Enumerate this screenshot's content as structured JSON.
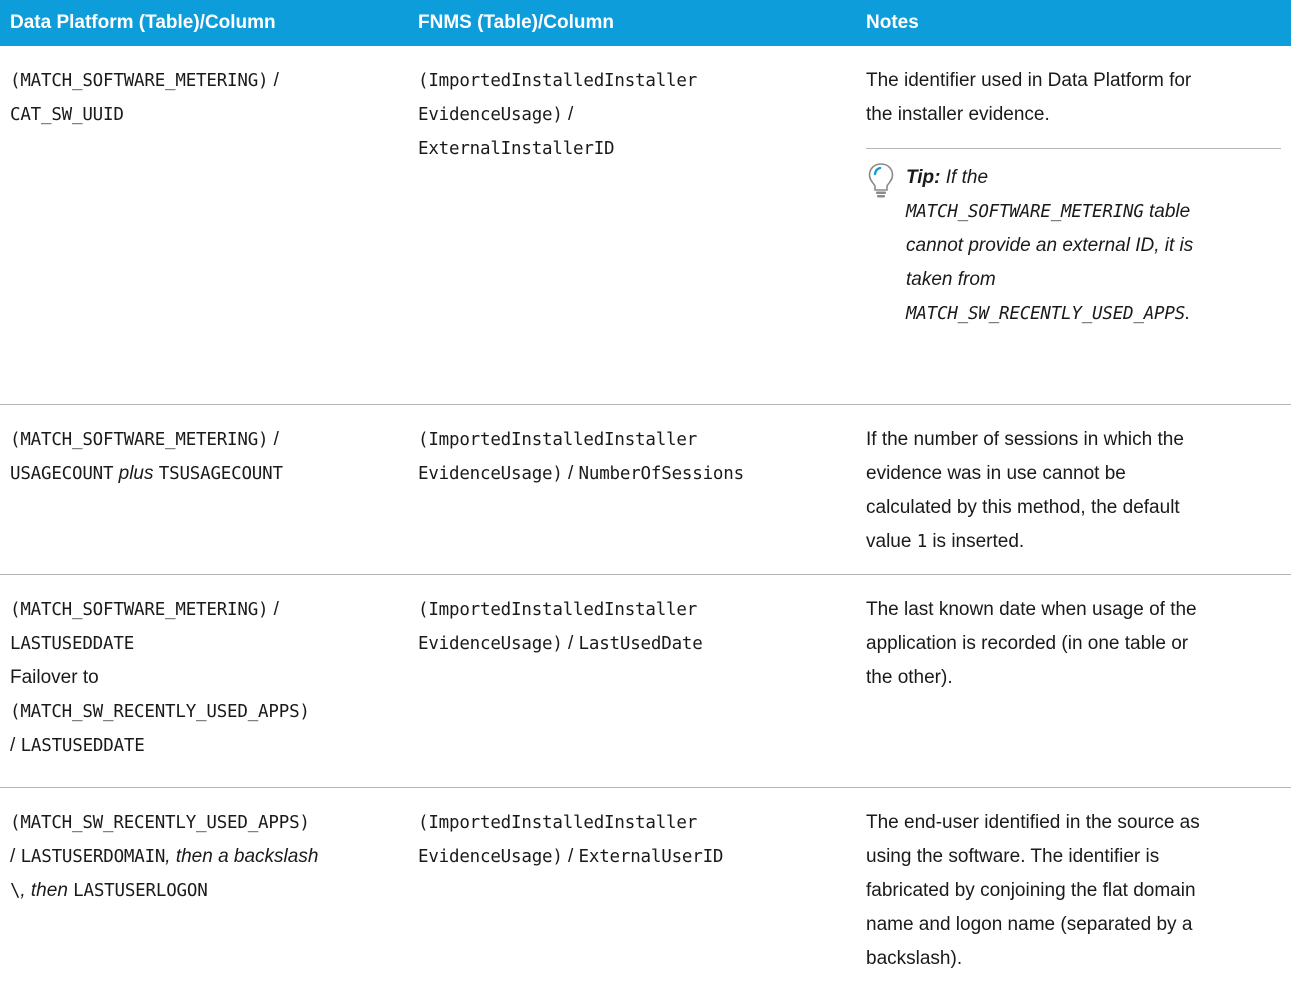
{
  "headers": {
    "col1": "Data Platform (Table)/Column",
    "col2": "FNMS (Table)/Column",
    "col3": "Notes"
  },
  "rows": [
    {
      "dp": {
        "l1": "(MATCH_SOFTWARE_METERING)",
        "l1_sep": " /",
        "l2": "CAT_SW_UUID"
      },
      "fnms": {
        "l1": "(ImportedInstalledInstaller",
        "l2": "EvidenceUsage)",
        "l2_sep": " /",
        "l3": "ExternalInstallerID"
      },
      "notes": {
        "l1": "The identifier used in Data Platform for",
        "l2": "the installer evidence.",
        "tip": {
          "label": "Tip:",
          "l1": " If the",
          "l2_code": "MATCH_SOFTWARE_METERING",
          "l2_text": " table",
          "l3": "cannot provide an external ID, it is",
          "l4": "taken from",
          "l5_code": "MATCH_SW_RECENTLY_USED_APPS",
          "l5_text": "."
        }
      }
    },
    {
      "dp": {
        "l1": "(MATCH_SOFTWARE_METERING)",
        "l1_sep": " /",
        "l2_code1": "USAGECOUNT",
        "l2_plus": " plus ",
        "l2_code2": "TSUSAGECOUNT"
      },
      "fnms": {
        "l1": "(ImportedInstalledInstaller",
        "l2": "EvidenceUsage)",
        "l2_sep": " / ",
        "l2_code": "NumberOfSessions"
      },
      "notes": {
        "l1": "If the number of sessions in which the",
        "l2": "evidence was in use cannot be",
        "l3": "calculated by this method, the default",
        "l4_a": "value ",
        "l4_code": "1",
        "l4_b": " is inserted."
      }
    },
    {
      "dp": {
        "l1": "(MATCH_SOFTWARE_METERING)",
        "l1_sep": " /",
        "l2": "LASTUSEDDATE",
        "l3": "Failover to",
        "l4": "(MATCH_SW_RECENTLY_USED_APPS)",
        "l5_sep": "/ ",
        "l5": "LASTUSEDDATE"
      },
      "fnms": {
        "l1": "(ImportedInstalledInstaller",
        "l2": "EvidenceUsage)",
        "l2_sep": " / ",
        "l2_code": "LastUsedDate"
      },
      "notes": {
        "l1": "The last known date when usage of the",
        "l2": "application is recorded (in one table or",
        "l3": "the other)."
      }
    },
    {
      "dp": {
        "l1": "(MATCH_SW_RECENTLY_USED_APPS)",
        "l2_sep": "/ ",
        "l2_code": "LASTUSERDOMAIN",
        "l2_it": ", then a backslash",
        "l3_code": "\\",
        "l3_it": ", then ",
        "l3_code2": "LASTUSERLOGON"
      },
      "fnms": {
        "l1": "(ImportedInstalledInstaller",
        "l2": "EvidenceUsage)",
        "l2_sep": " / ",
        "l2_code": "ExternalUserID"
      },
      "notes": {
        "l1": "The end-user identified in the source as",
        "l2": "using the software. The identifier is",
        "l3": "fabricated by conjoining the flat domain",
        "l4": "name and logon name (separated by a",
        "l5": "backslash)."
      }
    }
  ],
  "colors": {
    "header_bg": "#0d9ddb",
    "header_text": "#ffffff",
    "divider": "#b5b5b5"
  },
  "icons": {
    "tip": "lightbulb-icon"
  }
}
